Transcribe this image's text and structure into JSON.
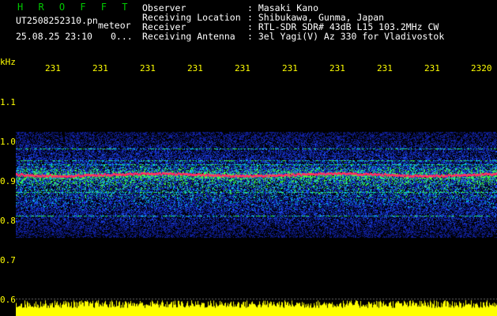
{
  "header": {
    "brand": "H R O F F T",
    "filename": "UT2508252310.pn",
    "filename_tag": "meteor",
    "datetime": "25.08.25 23:10",
    "counter": "0..."
  },
  "info": {
    "rows": [
      {
        "label": "Observer",
        "value": ": Masaki Kano"
      },
      {
        "label": "Receiving Location",
        "value": ": Shibukawa, Gunma, Japan"
      },
      {
        "label": "Receiver",
        "value": ": RTL-SDR SDR# 43dB L15 103.2MHz CW"
      },
      {
        "label": "Receiving Antenna",
        "value": ": 3el Yagi(V) Az 330 for Vladivostok"
      }
    ]
  },
  "axis": {
    "unit": "kHz",
    "y_ticks": [
      "1.1",
      "1.0",
      "0.9",
      "0.8",
      "0.7",
      "0.6"
    ],
    "y_range": [
      0.6,
      1.1
    ],
    "x_ticks": [
      "231",
      "231",
      "231",
      "231",
      "231",
      "231",
      "231",
      "231",
      "231",
      "2320"
    ]
  },
  "spectrogram": {
    "band_low_khz": 0.76,
    "band_high_khz": 1.025,
    "carrier_khz": 0.918,
    "colors": {
      "background": "#000000",
      "noise_low": "#1020a0",
      "noise_mid": "#1e50ff",
      "noise_high": "#00e0e0",
      "signal_green": "#40ff40",
      "carrier": "#ff3060",
      "level_trace": "#ffff00",
      "grid": "#6a6a6a"
    }
  }
}
